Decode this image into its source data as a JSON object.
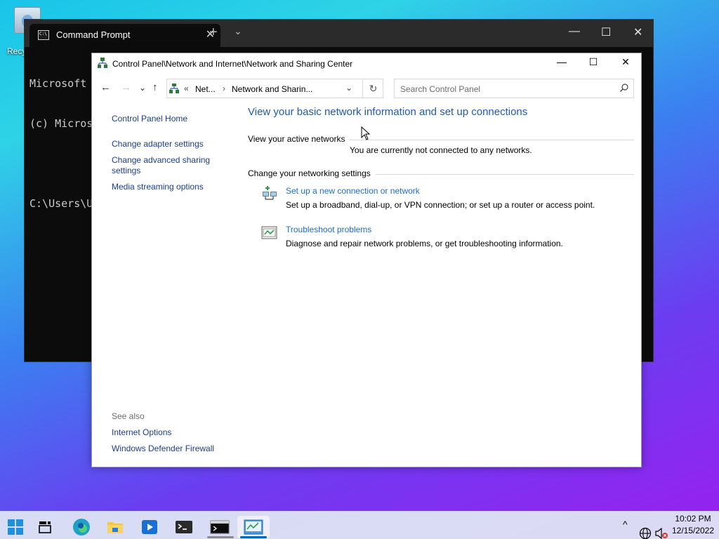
{
  "desktop": {
    "recycle_label": "Recy"
  },
  "terminal": {
    "tab_title": "Command Prompt",
    "lines": [
      "Microsoft",
      "(c) Micros",
      "",
      "C:\\Users\\U"
    ],
    "close": "✕",
    "new_tab": "+",
    "dropdown": "⌄",
    "min": "—",
    "max": "☐",
    "win_close": "✕"
  },
  "window": {
    "title": "Control Panel\\Network and Internet\\Network and Sharing Center",
    "min": "—",
    "max": "☐",
    "close": "✕"
  },
  "nav": {
    "back": "←",
    "forward": "→",
    "recent": "⌄",
    "up": "↑",
    "address_chevrons": "«",
    "address_seg1": "Net...",
    "address_sep": "›",
    "address_seg2": "Network and Sharin...",
    "address_dropdown": "⌄",
    "refresh": "↻",
    "search_placeholder": "Search Control Panel"
  },
  "left_pane": {
    "home": "Control Panel Home",
    "adapter": "Change adapter settings",
    "advanced": "Change advanced sharing settings",
    "media": "Media streaming options",
    "see_also": "See also",
    "internet_options": "Internet Options",
    "firewall": "Windows Defender Firewall"
  },
  "main": {
    "heading": "View your basic network information and set up connections",
    "active_networks": "View your active networks",
    "not_connected": "You are currently not connected to any networks.",
    "change_settings": "Change your networking settings",
    "task1_link": "Set up a new connection or network",
    "task1_desc": "Set up a broadband, dial-up, or VPN connection; or set up a router or access point.",
    "task2_link": "Troubleshoot problems",
    "task2_desc": "Diagnose and repair network problems, or get troubleshooting information."
  },
  "taskbar": {
    "time": "10:02 PM",
    "date": "12/15/2022",
    "tray_chevron": "^"
  },
  "colors": {
    "accent": "#0067c0",
    "link": "#1e6ec8",
    "heading": "#1e5bb3"
  }
}
